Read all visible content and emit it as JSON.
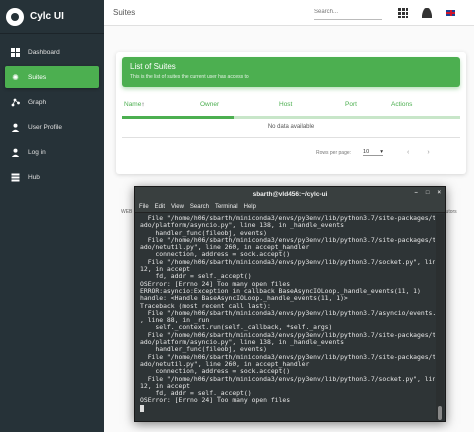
{
  "app": {
    "name": "Cylc UI"
  },
  "sidebar": {
    "items": [
      {
        "label": "Dashboard",
        "icon": "dashboard-icon"
      },
      {
        "label": "Suites",
        "icon": "suites-icon"
      },
      {
        "label": "Graph",
        "icon": "graph-icon"
      },
      {
        "label": "User Profile",
        "icon": "user-profile-icon"
      },
      {
        "label": "Log in",
        "icon": "login-icon"
      },
      {
        "label": "Hub",
        "icon": "hub-icon"
      }
    ],
    "active_index": 1
  },
  "topbar": {
    "title": "Suites",
    "search_placeholder": "Search...",
    "icons": [
      "apps-icon",
      "account-icon",
      "uk-flag-icon"
    ]
  },
  "suites_card": {
    "title": "List of Suites",
    "subtitle": "This is the list of suites the current user has access to",
    "columns": [
      "Name",
      "Owner",
      "Host",
      "Port",
      "Actions"
    ],
    "sort_indicator": "↑",
    "loading_progress": 0.33,
    "empty_text": "No data available",
    "rows_per_page_label": "Rows per page:",
    "rows_per_page_value": "10",
    "dropdown_arrow": "▾",
    "prev_arrow": "‹",
    "next_arrow": "›"
  },
  "footer": {
    "left": "WEB",
    "right": "ributors"
  },
  "colors": {
    "accent": "#4caf50",
    "sidebar_bg": "#263238",
    "terminal_bg": "#2e3436"
  },
  "terminal": {
    "title": "sbarth@vld456:~/cylc-ui",
    "window_buttons": [
      "–",
      "□",
      "×"
    ],
    "menu": [
      "File",
      "Edit",
      "View",
      "Search",
      "Terminal",
      "Help"
    ],
    "lines": [
      "  File \"/home/h06/sbarth/miniconda3/envs/py3env/lib/python3.7/site-packages/torn",
      "ado/platform/asyncio.py\", line 138, in _handle_events",
      "    handler_func(fileobj, events)",
      "  File \"/home/h06/sbarth/miniconda3/envs/py3env/lib/python3.7/site-packages/torn",
      "ado/netutil.py\", line 260, in accept_handler",
      "    connection, address = sock.accept()",
      "  File \"/home/h06/sbarth/miniconda3/envs/py3env/lib/python3.7/socket.py\", line 2",
      "12, in accept",
      "    fd, addr = self._accept()",
      "OSError: [Errno 24] Too many open files",
      "ERROR:asyncio:Exception in callback BaseAsyncIOLoop._handle_events(11, 1)",
      "handle: <Handle BaseAsyncIOLoop._handle_events(11, 1)>",
      "Traceback (most recent call last):",
      "  File \"/home/h06/sbarth/miniconda3/envs/py3env/lib/python3.7/asyncio/events.py\"",
      ", line 88, in _run",
      "    self._context.run(self._callback, *self._args)",
      "  File \"/home/h06/sbarth/miniconda3/envs/py3env/lib/python3.7/site-packages/torn",
      "ado/platform/asyncio.py\", line 138, in _handle_events",
      "    handler_func(fileobj, events)",
      "  File \"/home/h06/sbarth/miniconda3/envs/py3env/lib/python3.7/site-packages/torn",
      "ado/netutil.py\", line 260, in accept_handler",
      "    connection, address = sock.accept()",
      "  File \"/home/h06/sbarth/miniconda3/envs/py3env/lib/python3.7/socket.py\", line 2",
      "12, in accept",
      "    fd, addr = self._accept()",
      "OSError: [Errno 24] Too many open files"
    ]
  }
}
